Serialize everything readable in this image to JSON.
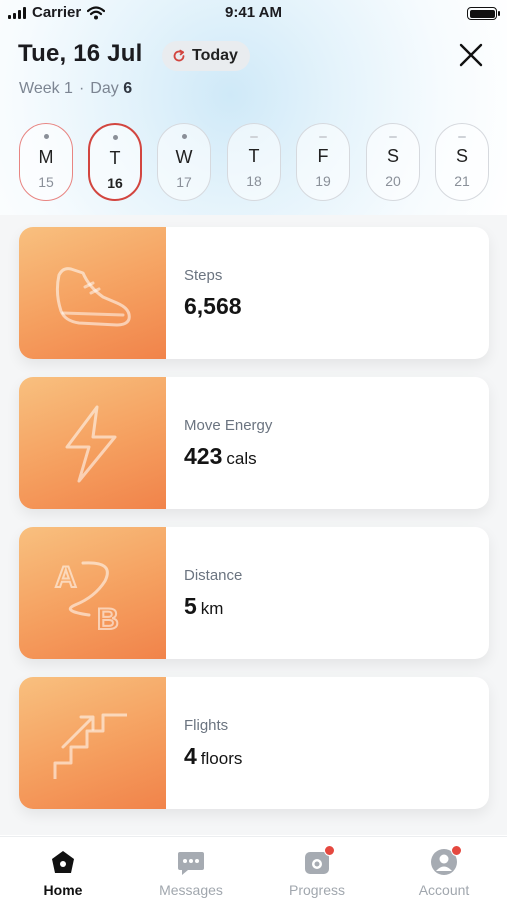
{
  "status_bar": {
    "carrier": "Carrier",
    "time": "9:41 AM"
  },
  "header": {
    "date_title": "Tue, 16 Jul",
    "today_label": "Today",
    "week_label": "Week 1",
    "day_prefix": "Day",
    "day_number": "6"
  },
  "days": [
    {
      "letter": "M",
      "num": "15"
    },
    {
      "letter": "T",
      "num": "16"
    },
    {
      "letter": "W",
      "num": "17"
    },
    {
      "letter": "T",
      "num": "18"
    },
    {
      "letter": "F",
      "num": "19"
    },
    {
      "letter": "S",
      "num": "20"
    },
    {
      "letter": "S",
      "num": "21"
    }
  ],
  "cards": [
    {
      "label": "Steps",
      "value": "6,568",
      "unit": "",
      "icon": "shoe-icon"
    },
    {
      "label": "Move Energy",
      "value": "423",
      "unit": "cals",
      "icon": "lightning-icon"
    },
    {
      "label": "Distance",
      "value": "5",
      "unit": "km",
      "icon": "a-to-b-icon"
    },
    {
      "label": "Flights",
      "value": "4",
      "unit": "floors",
      "icon": "stairs-icon"
    }
  ],
  "tabs": [
    {
      "label": "Home",
      "icon": "home-icon"
    },
    {
      "label": "Messages",
      "icon": "messages-icon"
    },
    {
      "label": "Progress",
      "icon": "progress-icon"
    },
    {
      "label": "Account",
      "icon": "account-icon"
    }
  ],
  "colors": {
    "accent_red": "#d2453f",
    "card_orange": "#f59f5f",
    "badge_red": "#e5483f"
  }
}
